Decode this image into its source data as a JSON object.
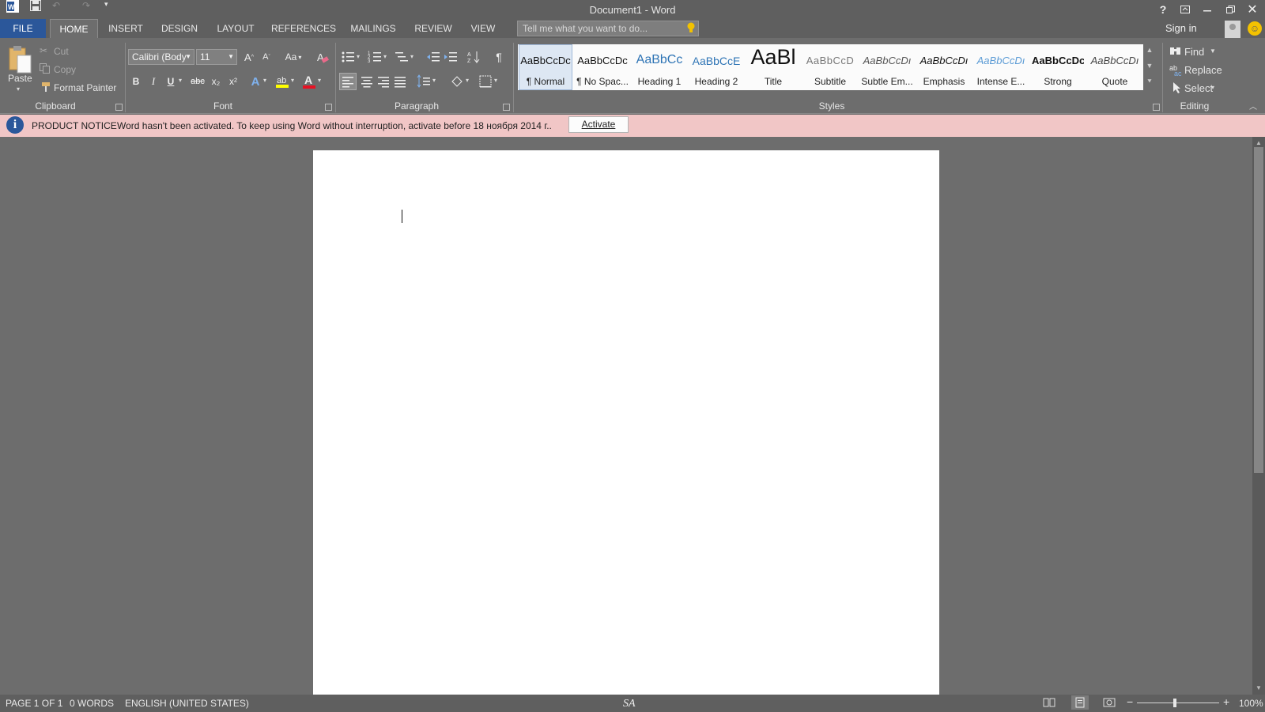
{
  "title_bar": {
    "document_title": "Document1 - Word",
    "help": "?",
    "quick_access": [
      "word-logo-icon",
      "save-icon",
      "undo-icon",
      "redo-icon",
      "customize-qat-icon"
    ]
  },
  "tabs": [
    "FILE",
    "HOME",
    "INSERT",
    "DESIGN",
    "LAYOUT",
    "REFERENCES",
    "MAILINGS",
    "REVIEW",
    "VIEW"
  ],
  "active_tab": "HOME",
  "tell_me": {
    "placeholder": "Tell me what you want to do..."
  },
  "account": {
    "sign_in": "Sign in"
  },
  "clipboard": {
    "label": "Clipboard",
    "paste": "Paste",
    "cut": "Cut",
    "copy": "Copy",
    "format_painter": "Format Painter"
  },
  "font": {
    "label": "Font",
    "font_name": "Calibri (Body",
    "font_size": "11",
    "change_case": "Aa",
    "bold": "B",
    "italic": "I",
    "underline": "U",
    "strikethrough": "abc",
    "subscript": "x₂",
    "superscript": "x²",
    "text_effects": "A",
    "font_color": "A"
  },
  "paragraph": {
    "label": "Paragraph",
    "show_marks": "¶"
  },
  "styles": {
    "label": "Styles",
    "items": [
      {
        "preview": "AaBbCcDc",
        "name": "¶ Normal"
      },
      {
        "preview": "AaBbCcDc",
        "name": "¶ No Spac..."
      },
      {
        "preview": "AaBbCc",
        "name": "Heading 1"
      },
      {
        "preview": "AaBbCcE",
        "name": "Heading 2"
      },
      {
        "preview": "AaBl",
        "name": "Title"
      },
      {
        "preview": "AaBbCcD",
        "name": "Subtitle"
      },
      {
        "preview": "AaBbCcDı",
        "name": "Subtle Em..."
      },
      {
        "preview": "AaBbCcDı",
        "name": "Emphasis"
      },
      {
        "preview": "AaBbCcDı",
        "name": "Intense E..."
      },
      {
        "preview": "AaBbCcDc",
        "name": "Strong"
      },
      {
        "preview": "AaBbCcDı",
        "name": "Quote"
      }
    ]
  },
  "editing": {
    "label": "Editing",
    "find": "Find",
    "replace": "Replace",
    "select": "Select"
  },
  "notice": {
    "title": "PRODUCT NOTICE",
    "message": "Word hasn't been activated. To keep using Word without interruption, activate before 18 ноября 2014 г..",
    "button": "Activate"
  },
  "status": {
    "page": "PAGE 1 OF 1",
    "words": "0 WORDS",
    "language": "ENGLISH (UNITED STATES)",
    "center_text": "SA",
    "zoom": "100%"
  },
  "colors": {
    "file_tab": "#2b579a",
    "notice_bg": "#f1c6c6",
    "highlight": "#ffff00",
    "font_color": "#e81123"
  }
}
